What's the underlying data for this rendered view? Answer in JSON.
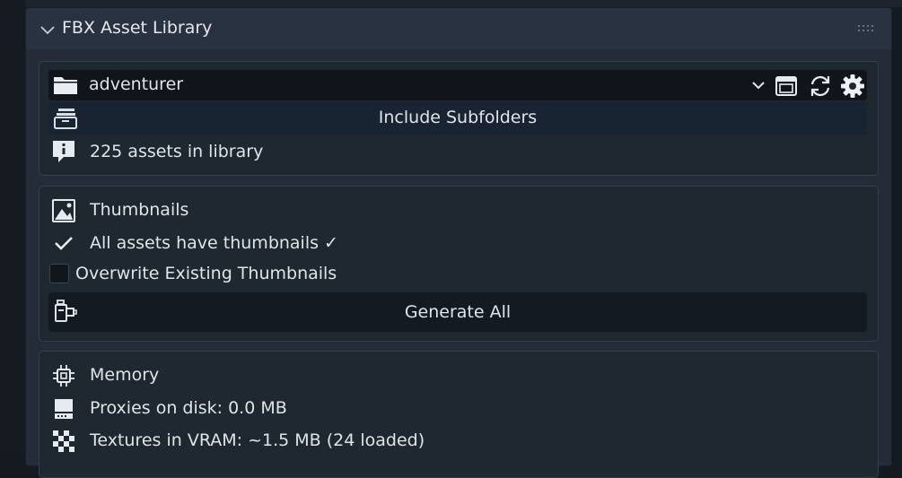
{
  "panel": {
    "title": "FBX Asset Library"
  },
  "library": {
    "folder_name": "adventurer",
    "include_subfolders_label": "Include Subfolders",
    "asset_count_text": "225 assets in library"
  },
  "thumbnails": {
    "heading": "Thumbnails",
    "status_text": "All assets have thumbnails ✓",
    "overwrite_label": "Overwrite Existing Thumbnails",
    "overwrite_checked": false,
    "generate_label": "Generate All"
  },
  "memory": {
    "heading": "Memory",
    "proxies_text": "Proxies on disk: 0.0 MB",
    "textures_text": "Textures in VRAM: ~1.5 MB (24 loaded)"
  },
  "icons": {
    "collapse": "chevron-down-icon",
    "drag": "drag-handle-icon",
    "folder": "folder-icon",
    "dropdown": "chevron-down-icon",
    "window": "window-icon",
    "refresh": "refresh-icon",
    "settings": "gear-icon",
    "subfolders": "archive-icon",
    "info": "info-icon",
    "thumbnails": "image-icon",
    "check": "check-icon",
    "generate": "camera-icon",
    "memory": "chip-icon",
    "disk": "disk-icon",
    "textures": "checker-icon"
  },
  "colors": {
    "panel_bg": "#232c38",
    "box_bg": "#1f2731",
    "field_bg": "#10151c",
    "text": "#dfe4ea"
  }
}
